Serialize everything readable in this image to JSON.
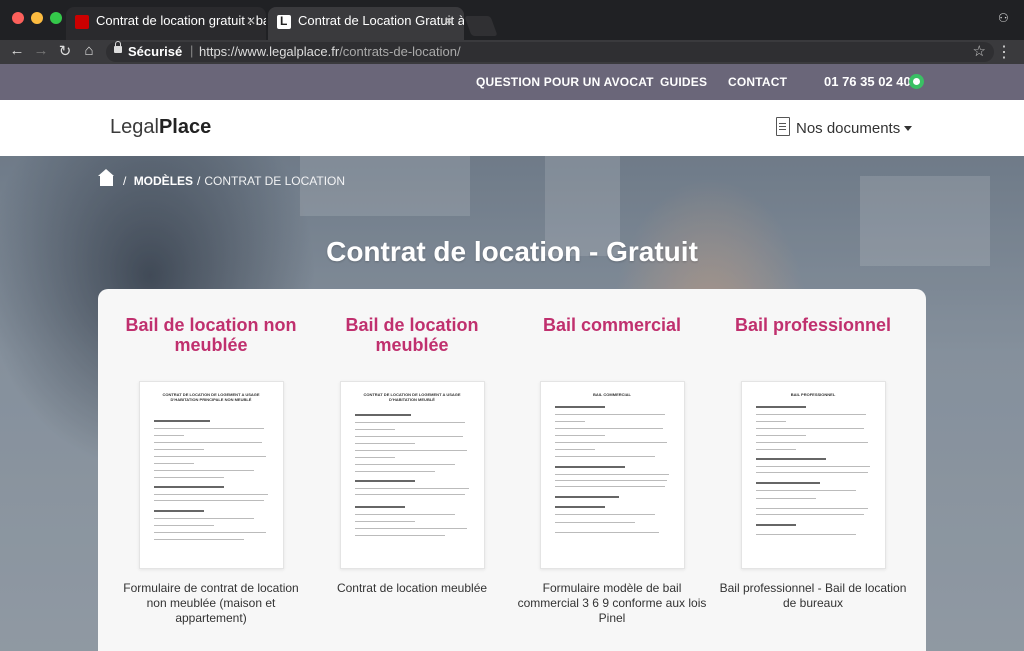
{
  "browser": {
    "tabs": [
      {
        "title": "Contrat de location gratuit : ba"
      },
      {
        "title": "Contrat de Location Gratuit à l"
      }
    ],
    "secure_label": "Sécurisé",
    "url_host": "https://www.legalplace.fr",
    "url_path": "/contrats-de-location/"
  },
  "topbar": {
    "links": [
      "QUESTION POUR UN AVOCAT",
      "GUIDES",
      "CONTACT"
    ],
    "phone": "01 76 35 02 40"
  },
  "header": {
    "logo_light": "Legal",
    "logo_bold": "Place",
    "docs_label": "Nos documents"
  },
  "breadcrumb": {
    "section": "MODÈLES",
    "current": "CONTRAT DE LOCATION"
  },
  "hero": {
    "title": "Contrat de location - Gratuit"
  },
  "cards": [
    {
      "title": "Bail de location non meublée",
      "doc_heading": "CONTRAT DE LOCATION DE LOGEMENT A USAGE D'HABITATION PRINCIPALE NON MEUBLÉ",
      "description": "Formulaire de contrat de location non meublée (maison et appartement)"
    },
    {
      "title": "Bail de location meublée",
      "doc_heading": "CONTRAT DE LOCATION DE LOGEMENT A USAGE D'HABITATION MEUBLÉ",
      "description": "Contrat de location meublée"
    },
    {
      "title": "Bail commercial",
      "doc_heading": "BAIL COMMERCIAL",
      "description": "Formulaire modèle de bail commercial 3 6 9 conforme aux lois Pinel"
    },
    {
      "title": "Bail professionnel",
      "doc_heading": "BAIL PROFESSIONNEL",
      "description": "Bail professionnel - Bail de location de bureaux"
    }
  ],
  "colors": {
    "accent": "#c0306e",
    "topbar": "#6a6679",
    "whatsapp": "#3ac064"
  }
}
